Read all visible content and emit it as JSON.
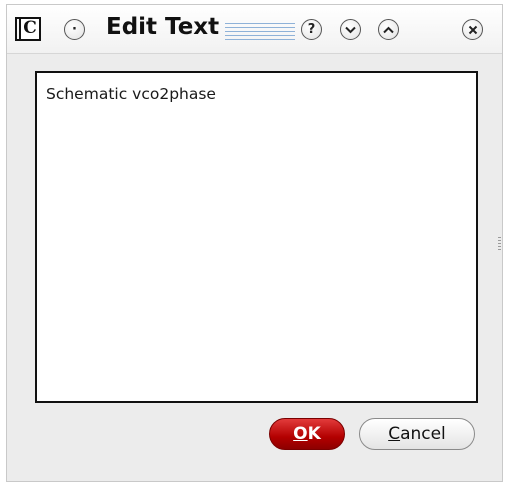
{
  "window": {
    "title": "Edit Text",
    "app_icon_letter": "C"
  },
  "titlebar_buttons": {
    "menu": "·",
    "help": "?",
    "minimize": "⌄",
    "maximize": "⌃",
    "close": "✕"
  },
  "editor": {
    "value": "Schematic vco2phase"
  },
  "buttons": {
    "ok_label": "OK",
    "cancel_label": "Cancel"
  },
  "colors": {
    "ok_button": "#b30000",
    "window_bg": "#ececec"
  }
}
